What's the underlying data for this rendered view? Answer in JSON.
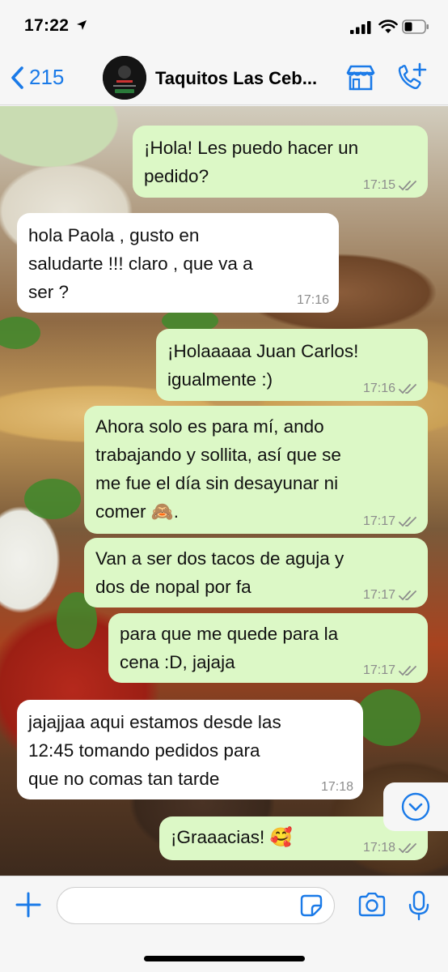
{
  "status_bar": {
    "time": "17:22"
  },
  "header": {
    "back_count": "215",
    "contact_name": "Taquitos Las Ceb..."
  },
  "messages": [
    {
      "direction": "out",
      "text": "¡Hola! Les puedo hacer un\npedido?",
      "time": "17:15"
    },
    {
      "direction": "in",
      "text": "hola Paola , gusto en\nsaludarte !!! claro , que va a\nser ?",
      "time": "17:16"
    },
    {
      "direction": "out",
      "text": "¡Holaaaaa Juan Carlos!\nigualmente :)",
      "time": "17:16"
    },
    {
      "direction": "out",
      "text": "Ahora solo es para mí, ando\ntrabajando y sollita, así que se\nme fue el día sin desayunar ni\ncomer 🙈.",
      "time": "17:17"
    },
    {
      "direction": "out",
      "text": "Van a ser dos tacos de aguja y\ndos de nopal por fa",
      "time": "17:17"
    },
    {
      "direction": "out",
      "text": "para que me quede para la\ncena :D, jajaja",
      "time": "17:17"
    },
    {
      "direction": "in",
      "text": "jajajjaa aqui estamos desde las\n12:45 tomando pedidos para\nque no comas tan tarde",
      "time": "17:18"
    },
    {
      "direction": "out",
      "text": "¡Graaacias! 🥰",
      "time": "17:18"
    }
  ],
  "input": {
    "placeholder": ""
  },
  "colors": {
    "accent": "#1a7ae8",
    "outgoing_bubble": "#dcf8c6",
    "incoming_bubble": "#ffffff",
    "read_ticks": "#8c8c8c"
  },
  "icons": {
    "back": "chevron-left-icon",
    "store": "store-icon",
    "call": "phone-add-icon",
    "scroll_down": "chevron-down-circle-icon",
    "plus": "plus-icon",
    "sticker": "sticker-icon",
    "camera": "camera-icon",
    "mic": "microphone-icon"
  }
}
